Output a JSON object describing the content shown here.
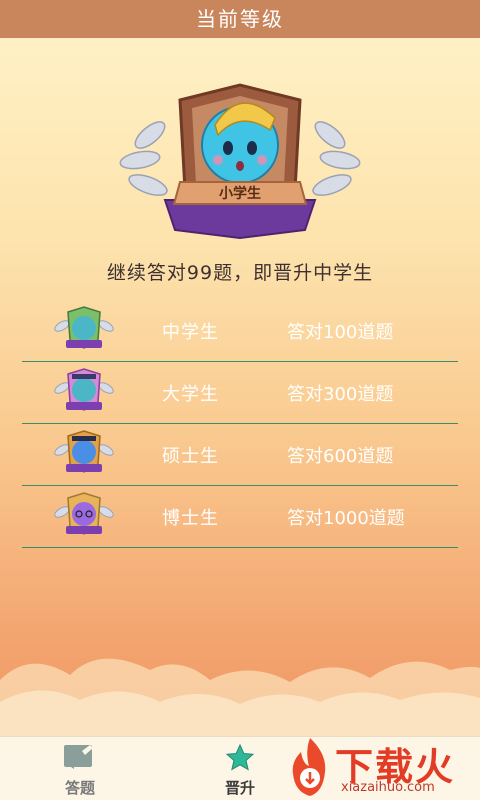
{
  "header": {
    "title": "当前等级"
  },
  "current_level": {
    "badge_label": "小学生"
  },
  "progress": {
    "text": "继续答对99题，即晋升中学生"
  },
  "levels": [
    {
      "name": "中学生",
      "requirement": "答对100道题",
      "color": "#4ab6c6"
    },
    {
      "name": "大学生",
      "requirement": "答对300道题",
      "color": "#9b59d6"
    },
    {
      "name": "硕士生",
      "requirement": "答对600道题",
      "color": "#4a8ee6"
    },
    {
      "name": "博士生",
      "requirement": "答对1000道题",
      "color": "#8e5bd6"
    }
  ],
  "tabbar": {
    "tabs": [
      {
        "label": "答题",
        "icon": "pencil-note-icon"
      },
      {
        "label": "晋升",
        "icon": "star-icon"
      }
    ]
  },
  "watermark": {
    "title": "下载火",
    "subtitle": "xiazaihuo.com"
  },
  "colors": {
    "accent": "#3d8b6e",
    "title_bar": "#c9855b",
    "logo_red": "#e23b26"
  }
}
